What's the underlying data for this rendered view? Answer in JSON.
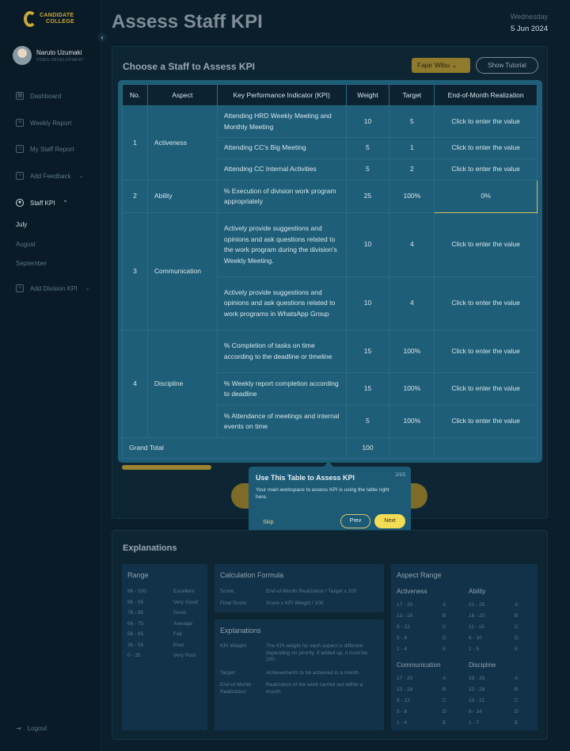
{
  "brand": {
    "line1": "CANDIDATE",
    "line2": "COLLEGE",
    "color": "#c9a83a"
  },
  "user": {
    "name": "Naruto Uzumaki",
    "role": "VIDEO DEVELOPMENT"
  },
  "nav": {
    "dashboard": "Dashboard",
    "weekly_report": "Weekly Report",
    "my_staff_report": "My Staff Report",
    "add_feedback": "Add Feedback",
    "staff_kpi": "Staff KPI",
    "months": [
      "July",
      "August",
      "September"
    ],
    "add_division_kpi": "Add Division KPI",
    "logout": "Logout"
  },
  "page": {
    "title": "Assess Staff KPI",
    "day": "Wednesday",
    "date": "5 Jun 2024"
  },
  "panel": {
    "title": "Choose a  Staff to Assess KPI",
    "selected_staff": "Fajar Wibu",
    "tutorial_button": "Show Tutorial"
  },
  "table": {
    "headers": [
      "No.",
      "Aspect",
      "Key Performance Indicator (KPI)",
      "Weight",
      "Target",
      "End-of-Month Realization"
    ],
    "rows": [
      {
        "no": "1",
        "aspect": "Activeness",
        "kpi": "Attending HRD Weekly Meeting and Monthly Meeting",
        "weight": "10",
        "target": "5",
        "realization": "Click to enter the value"
      },
      {
        "kpi": "Attending CC's Big Meeting",
        "weight": "5",
        "target": "1",
        "realization": "Click to enter the value"
      },
      {
        "kpi": "Attending CC Internal Activities",
        "weight": "5",
        "target": "2",
        "realization": "Click to enter the value"
      },
      {
        "no": "2",
        "aspect": "Ability",
        "kpi": "% Execution of division work program appropriately",
        "weight": "25",
        "target": "100%",
        "realization": "0%"
      },
      {
        "no": "3",
        "aspect": "Communication",
        "kpi": "Actively provide suggestions and opinions and ask questions related to the work program during the division's Weekly Meeting.",
        "weight": "10",
        "target": "4",
        "realization": "Click to enter the value"
      },
      {
        "kpi": "Actively provide suggestions and opinions and ask questions related to work programs in WhatsApp Group",
        "weight": "10",
        "target": "4",
        "realization": "Click to enter the value"
      },
      {
        "no": "4",
        "aspect": "Discipline",
        "kpi": "% Completion of tasks on time according to the deadline or timeline",
        "weight": "15",
        "target": "100%",
        "realization": "Click to enter the value"
      },
      {
        "kpi": "% Weekly report completion according to deadline",
        "weight": "15",
        "target": "100%",
        "realization": "Click to enter the value"
      },
      {
        "kpi": "% Attendance of meetings and internal events on time",
        "weight": "5",
        "target": "100%",
        "realization": "Click to enter the value"
      }
    ],
    "grand_total_label": "Grand Total",
    "grand_total_weight": "100"
  },
  "tooltip": {
    "title": "Use This Table to Assess KPI",
    "step": "2/15",
    "body": "Your main workspace to assess KPI is using the table right here.",
    "skip": "Skip",
    "prev": "Prev",
    "next": "Next"
  },
  "explanations": {
    "title": "Explanations",
    "range": {
      "title": "Range",
      "rows": [
        [
          "96 - 100",
          "Excellent"
        ],
        [
          "86 - 95",
          "Very Good"
        ],
        [
          "76 - 85",
          "Good"
        ],
        [
          "66 - 75",
          "Average"
        ],
        [
          "56 - 65",
          "Fair"
        ],
        [
          "36 - 55",
          "Poor"
        ],
        [
          "0 - 35",
          "Very Poor"
        ]
      ]
    },
    "formula": {
      "title": "Calculation Formula",
      "rows": [
        [
          "Score:",
          "End-of-Month Realization / Target x 100"
        ],
        [
          "Final Score:",
          "Score x KPI Weight / 100"
        ]
      ]
    },
    "terms": {
      "title": "Explanations",
      "rows": [
        [
          "KPI Weight:",
          "The KPI weight for each aspect is different depending on priority. If added up, it must be 100."
        ],
        [
          "Target:",
          "Achievements to be achieved in a month."
        ],
        [
          "End-of-Month Realization:",
          "Realization of the work carried out within a month."
        ]
      ]
    },
    "aspect_range": {
      "title": "Aspect Range",
      "groups": [
        {
          "name": "Activeness",
          "rows": [
            [
              "17 - 20",
              "A"
            ],
            [
              "13 - 16",
              "B"
            ],
            [
              "9 - 12",
              "C"
            ],
            [
              "5 - 8",
              "D"
            ],
            [
              "1 - 4",
              "E"
            ]
          ]
        },
        {
          "name": "Ability",
          "rows": [
            [
              "21 - 25",
              "A"
            ],
            [
              "16 - 20",
              "B"
            ],
            [
              "11 - 15",
              "C"
            ],
            [
              "6 - 10",
              "D"
            ],
            [
              "1 - 5",
              "E"
            ]
          ]
        },
        {
          "name": "Communication",
          "rows": [
            [
              "17 - 20",
              "A"
            ],
            [
              "13 - 16",
              "B"
            ],
            [
              "9 - 12",
              "C"
            ],
            [
              "5 - 8",
              "D"
            ],
            [
              "1 - 4",
              "E"
            ]
          ]
        },
        {
          "name": "Discipline",
          "rows": [
            [
              "29 - 35",
              "A"
            ],
            [
              "22 - 28",
              "B"
            ],
            [
              "15 - 21",
              "C"
            ],
            [
              "8 - 14",
              "D"
            ],
            [
              "1 - 7",
              "E"
            ]
          ]
        }
      ]
    }
  }
}
